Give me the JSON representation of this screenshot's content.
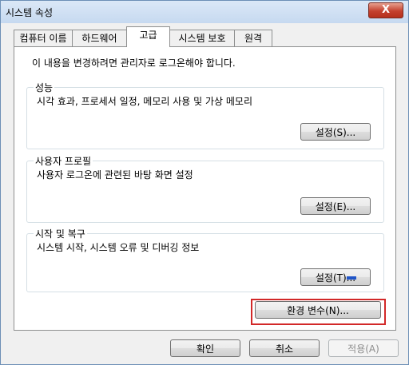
{
  "window": {
    "title": "시스템 속성",
    "close_label": "X"
  },
  "tabs": [
    {
      "label": "컴퓨터 이름"
    },
    {
      "label": "하드웨어"
    },
    {
      "label": "고급"
    },
    {
      "label": "시스템 보호"
    },
    {
      "label": "원격"
    }
  ],
  "intro": "이 내용을 변경하려면 관리자로 로그온해야 합니다.",
  "performance": {
    "title": "성능",
    "desc": "시각 효과, 프로세서 일정, 메모리 사용 및 가상 메모리",
    "button": "설정(S)..."
  },
  "user_profiles": {
    "title": "사용자 프로필",
    "desc": "사용자 로그온에 관련된 바탕 화면 설정",
    "button": "설정(E)..."
  },
  "startup": {
    "title": "시작 및 복구",
    "desc": "시스템 시작, 시스템 오류 및 디버깅 정보",
    "button": "설정(T)..."
  },
  "env_button": "환경 변수(N)...",
  "footer": {
    "ok": "확인",
    "cancel": "취소",
    "apply": "적용(A)"
  },
  "colors": {
    "highlight_border": "#d22828",
    "close_red": "#c4402d"
  }
}
